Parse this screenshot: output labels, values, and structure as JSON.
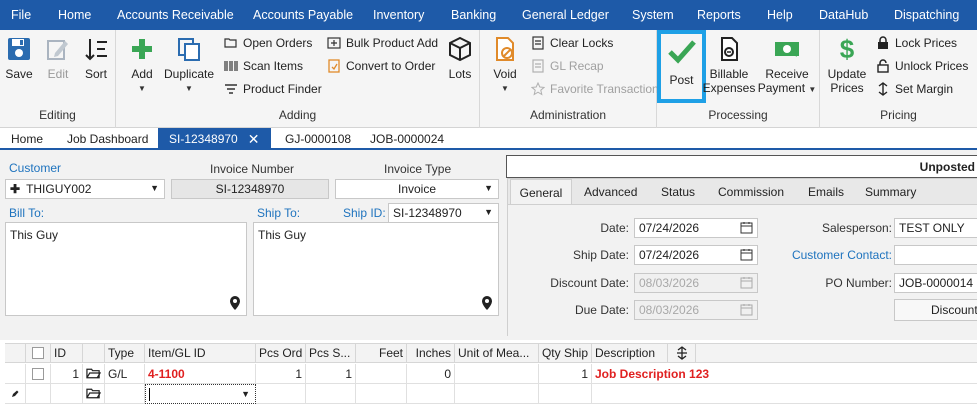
{
  "menu": [
    "File",
    "Home",
    "Accounts Receivable",
    "Accounts Payable",
    "Inventory",
    "Banking",
    "General Ledger",
    "System",
    "Reports",
    "Help",
    "DataHub",
    "Dispatching"
  ],
  "ribbon": {
    "editing": {
      "label": "Editing",
      "save": "Save",
      "edit": "Edit",
      "sort": "Sort"
    },
    "adding": {
      "label": "Adding",
      "add": "Add",
      "duplicate": "Duplicate",
      "open_orders": "Open Orders",
      "scan_items": "Scan Items",
      "product_finder": "Product Finder",
      "bulk_product_add": "Bulk Product Add",
      "convert_to_order": "Convert to Order",
      "lots": "Lots"
    },
    "administration": {
      "label": "Administration",
      "void": "Void",
      "clear_locks": "Clear Locks",
      "gl_recap": "GL Recap",
      "favorite_transaction": "Favorite Transaction"
    },
    "processing": {
      "label": "Processing",
      "post": "Post",
      "billable_expenses_1": "Billable",
      "billable_expenses_2": "Expenses",
      "receive_payment_1": "Receive",
      "receive_payment_2": "Payment"
    },
    "pricing": {
      "label": "Pricing",
      "update_prices_1": "Update",
      "update_prices_2": "Prices",
      "lock_prices": "Lock Prices",
      "unlock_prices": "Unlock Prices",
      "set_margin": "Set Margin"
    }
  },
  "tabs": {
    "home": "Home",
    "job_dashboard": "Job Dashboard",
    "si": "SI-12348970",
    "gj": "GJ-0000108",
    "job": "JOB-0000024",
    "close": "✕"
  },
  "form": {
    "customer_label": "Customer",
    "customer_value": "THIGUY002",
    "invoice_number_label": "Invoice Number",
    "invoice_number_value": "SI-12348970",
    "invoice_type_label": "Invoice Type",
    "invoice_type_value": "Invoice",
    "bill_to_label": "Bill To:",
    "bill_to_value": "This Guy",
    "ship_to_label": "Ship To:",
    "ship_to_value": "This Guy",
    "ship_id_label": "Ship ID:",
    "ship_id_value": "SI-12348970",
    "status_banner": "Unposted"
  },
  "panel": {
    "tabs": [
      "General",
      "Advanced",
      "Status",
      "Commission",
      "Emails",
      "Summary"
    ],
    "date_label": "Date:",
    "date_value": "07/24/2026",
    "ship_date_label": "Ship Date:",
    "ship_date_value": "07/24/2026",
    "discount_date_label": "Discount Date:",
    "discount_date_value": "08/03/2026",
    "due_date_label": "Due Date:",
    "due_date_value": "08/03/2026",
    "salesperson_label": "Salesperson:",
    "salesperson_value": "TEST ONLY",
    "customer_contact_label": "Customer Contact:",
    "customer_contact_value": "",
    "po_number_label": "PO Number:",
    "po_number_value": "JOB-0000014",
    "discount_button": "Discount"
  },
  "grid": {
    "headers": [
      "ID",
      "Type",
      "Item/GL ID",
      "Pcs Ord",
      "Pcs S...",
      "Feet",
      "Inches",
      "Unit of Mea...",
      "Qty Ship",
      "Description"
    ],
    "rows": [
      {
        "id": "1",
        "type": "G/L",
        "item": "4-1100",
        "pcs_ord": "1",
        "pcs_ship": "1",
        "feet": "",
        "inches": "0",
        "uom": "",
        "qty_ship": "1",
        "description": "Job Description 123"
      }
    ]
  },
  "colors": {
    "brand_blue": "#1e5aa8",
    "post_highlight": "#1ea0e6",
    "check_green": "#3aa655",
    "error_red": "#e02020"
  }
}
